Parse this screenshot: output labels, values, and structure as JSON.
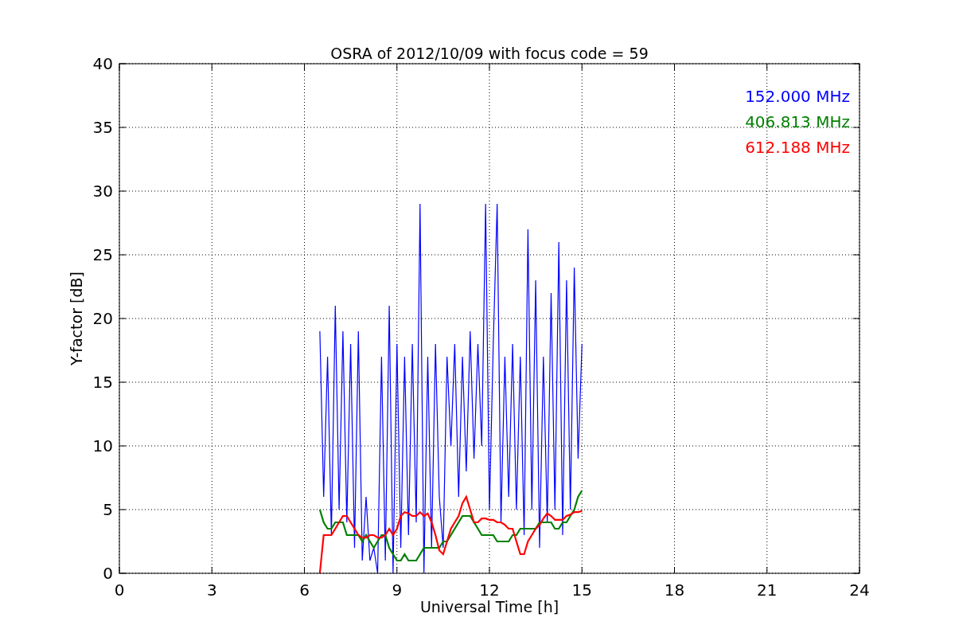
{
  "chart_data": {
    "type": "line",
    "title": "OSRA of 2012/10/09 with focus code = 59",
    "xlabel": "Universal Time [h]",
    "ylabel": "Y-factor [dB]",
    "x": [
      6.5,
      6.625,
      6.75,
      6.875,
      7,
      7.125,
      7.25,
      7.375,
      7.5,
      7.625,
      7.75,
      7.875,
      8,
      8.125,
      8.25,
      8.375,
      8.5,
      8.625,
      8.75,
      8.875,
      9,
      9.125,
      9.25,
      9.375,
      9.5,
      9.625,
      9.75,
      9.875,
      10,
      10.125,
      10.25,
      10.375,
      10.5,
      10.625,
      10.75,
      10.875,
      11,
      11.125,
      11.25,
      11.375,
      11.5,
      11.625,
      11.75,
      11.875,
      12,
      12.125,
      12.25,
      12.375,
      12.5,
      12.625,
      12.75,
      12.875,
      13,
      13.125,
      13.25,
      13.375,
      13.5,
      13.625,
      13.75,
      13.875,
      14,
      14.125,
      14.25,
      14.375,
      14.5,
      14.625,
      14.75,
      14.875,
      15
    ],
    "series": [
      {
        "name": "152.000 MHz",
        "color": "#0000ff",
        "values": [
          19,
          6,
          17,
          3,
          21,
          5,
          19,
          4,
          18,
          2,
          19,
          1,
          6,
          1,
          2,
          0,
          17,
          1,
          21,
          0,
          18,
          2,
          17,
          3,
          18,
          4,
          29,
          0,
          17,
          2,
          18,
          6,
          2,
          17,
          10,
          18,
          6,
          17,
          8,
          19,
          9,
          18,
          10,
          29,
          5,
          18,
          29,
          4,
          17,
          6,
          18,
          5,
          17,
          3,
          27,
          5,
          23,
          2,
          17,
          4,
          22,
          5,
          26,
          3,
          23,
          5,
          24,
          9,
          18
        ]
      },
      {
        "name": "406.813 MHz",
        "color": "#008000",
        "values": [
          5,
          4,
          3.5,
          3.5,
          4,
          4,
          4,
          3,
          3,
          3,
          3,
          2.5,
          3,
          2.5,
          2,
          2.5,
          3,
          3,
          2,
          1.5,
          1,
          1,
          1.5,
          1,
          1,
          1,
          1.5,
          2,
          2,
          2,
          2,
          2,
          2.5,
          2.5,
          3,
          3.5,
          4,
          4.5,
          4.5,
          4.5,
          4,
          3.5,
          3,
          3,
          3,
          3,
          2.5,
          2.5,
          2.5,
          2.5,
          3,
          3,
          3.5,
          3.5,
          3.5,
          3.5,
          3.5,
          4,
          4,
          4,
          4,
          3.5,
          3.5,
          4,
          4,
          4.5,
          5,
          6,
          6.5
        ]
      },
      {
        "name": "612.188 MHz",
        "color": "#ff0000",
        "values": [
          0,
          3,
          3,
          3,
          3.5,
          4,
          4.5,
          4.5,
          4,
          3.5,
          3,
          2.8,
          2.8,
          3,
          3,
          2.8,
          2.8,
          3,
          3.5,
          3,
          3.5,
          4.5,
          4.8,
          4.7,
          4.5,
          4.5,
          4.8,
          4.5,
          4.7,
          4,
          3,
          1.8,
          1.5,
          2.5,
          3.5,
          4,
          4.5,
          5.5,
          6,
          5,
          4,
          4,
          4.3,
          4.3,
          4.2,
          4.2,
          4,
          4,
          3.8,
          3.5,
          3.5,
          2.5,
          1.5,
          1.5,
          2.5,
          3,
          3.5,
          3.8,
          4.3,
          4.7,
          4.5,
          4.2,
          4.2,
          4.2,
          4.5,
          4.6,
          4.8,
          4.8,
          4.9
        ]
      }
    ],
    "grid": true,
    "xlim": [
      0,
      24
    ],
    "ylim": [
      0,
      40
    ],
    "xticks": [
      0,
      3,
      6,
      9,
      12,
      15,
      18,
      21,
      24
    ],
    "yticks": [
      0,
      5,
      10,
      15,
      20,
      25,
      30,
      35,
      40
    ]
  }
}
